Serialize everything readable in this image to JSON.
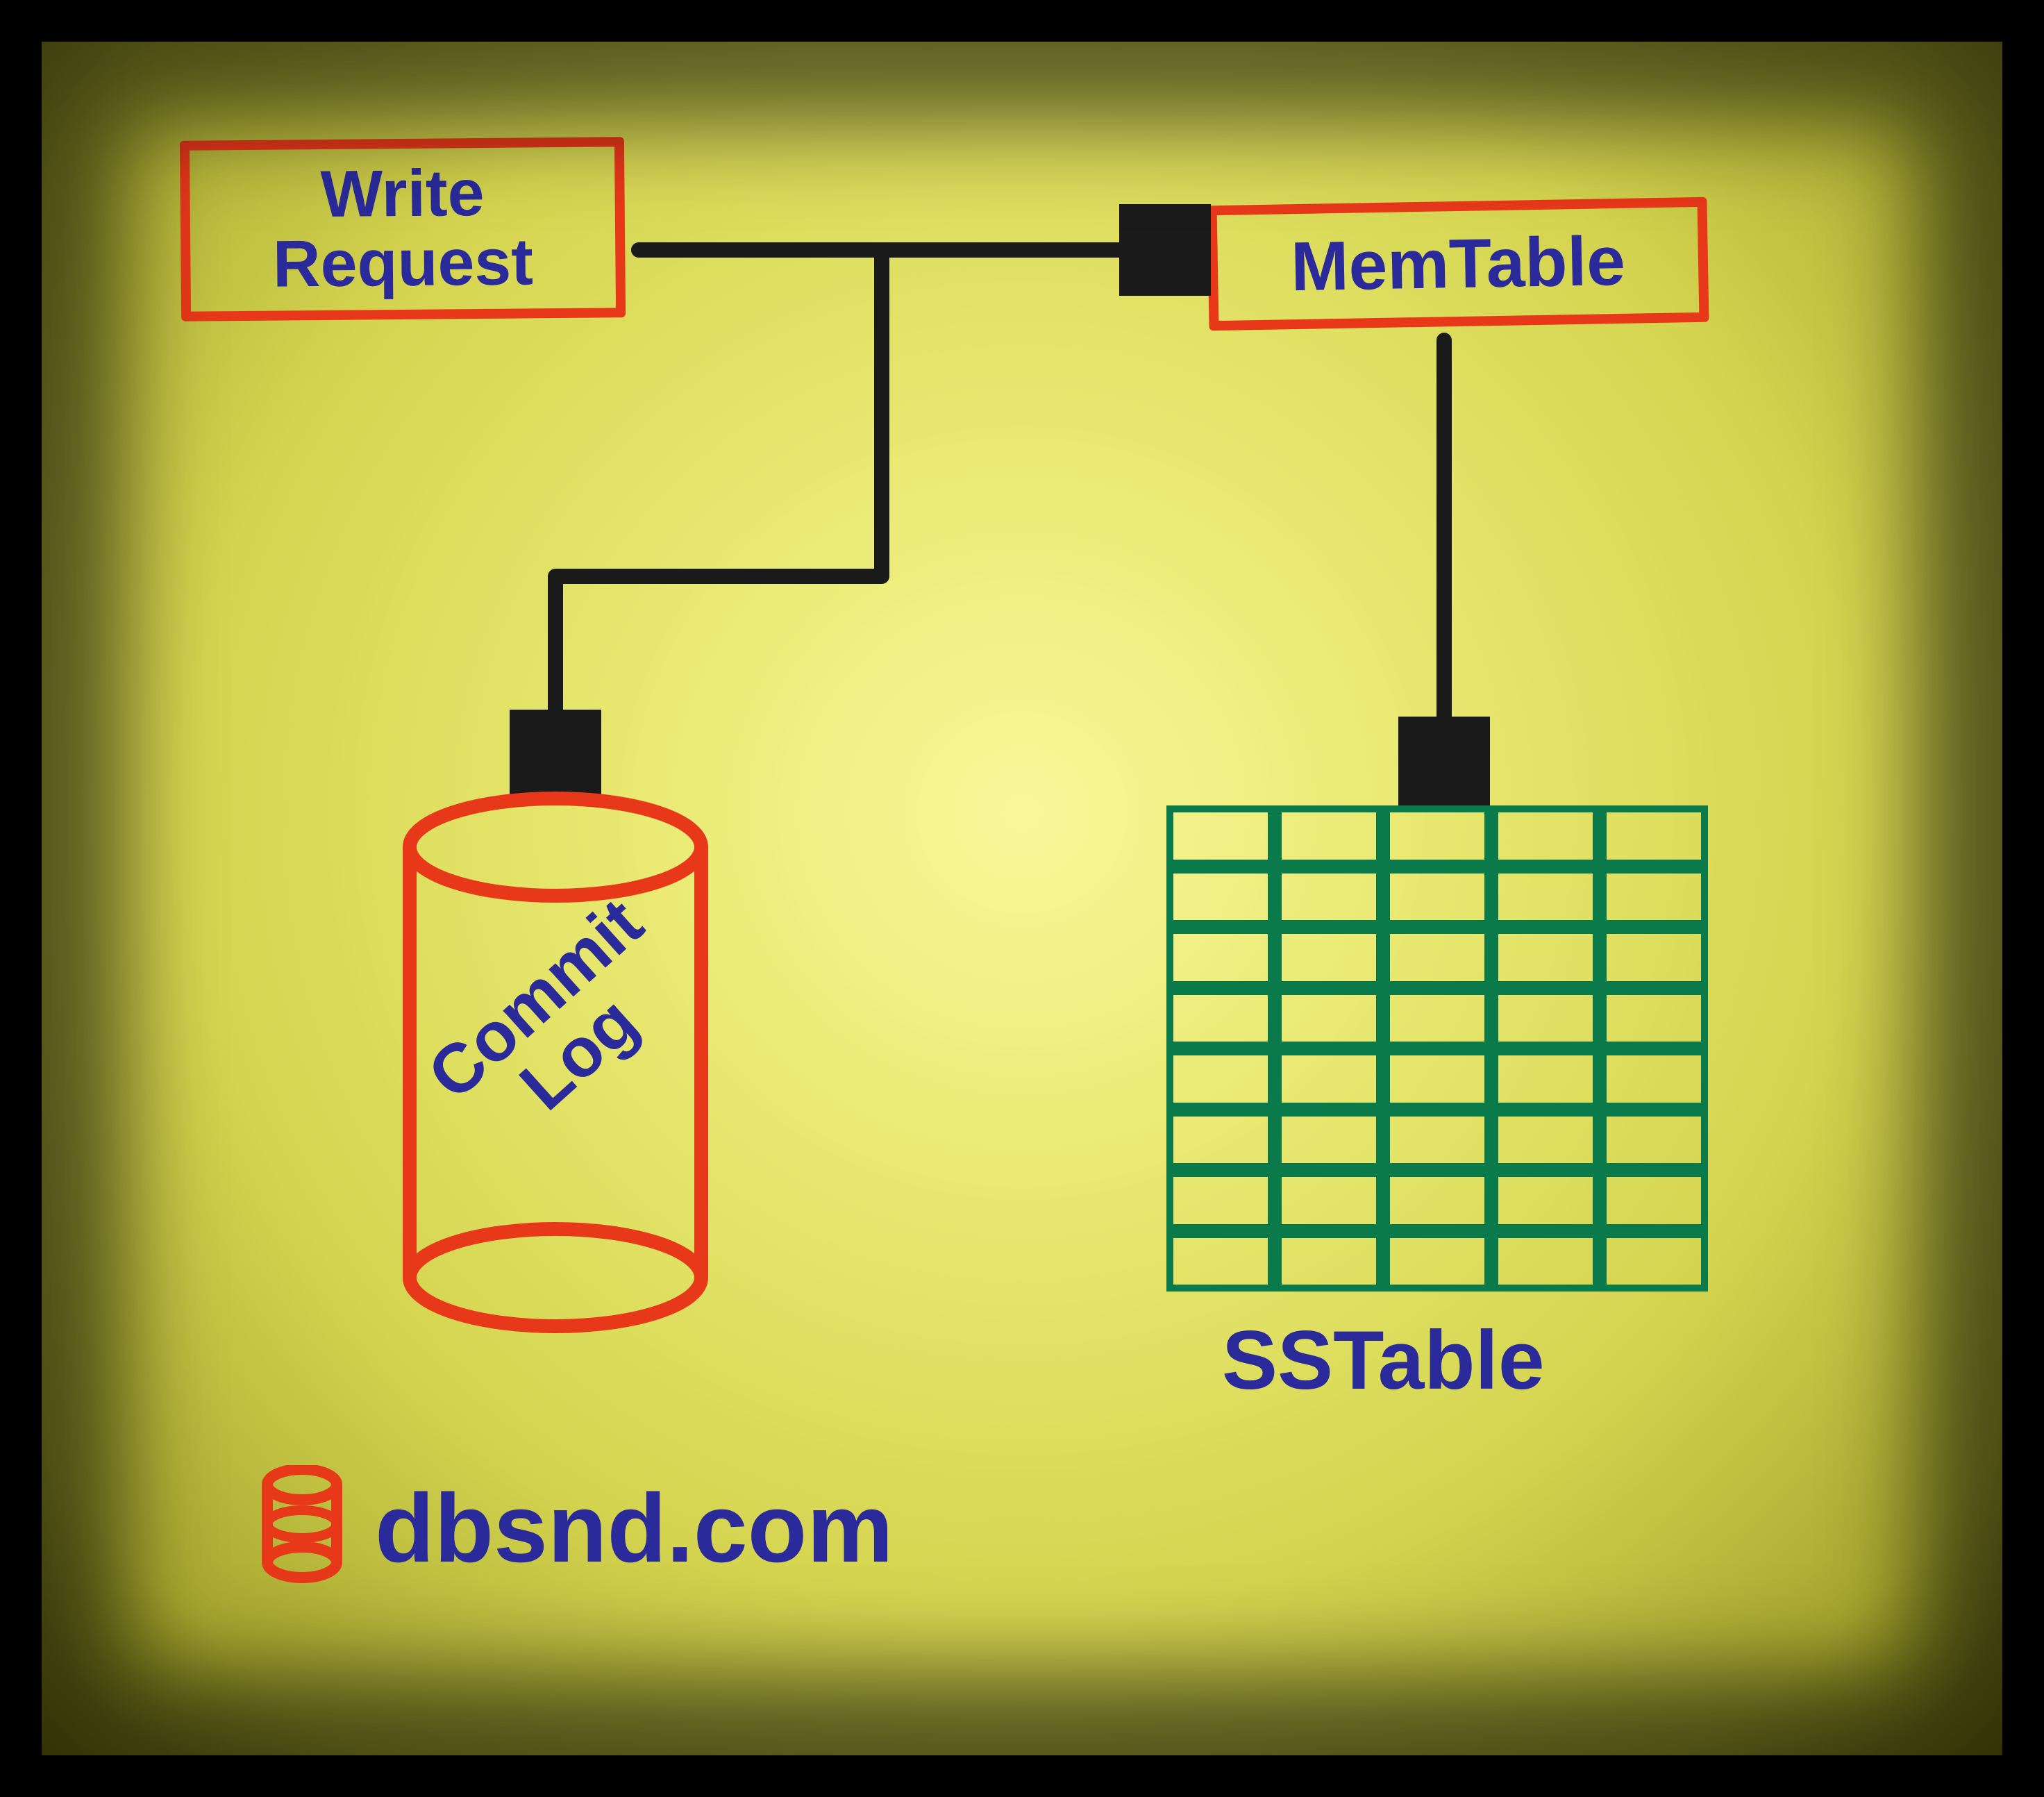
{
  "nodes": {
    "write_request": "Write\nRequest",
    "memtable": "MemTable",
    "commit_log": "Commit\nLog",
    "sstable": "SSTable"
  },
  "edges": [
    {
      "from": "write_request",
      "to": "memtable"
    },
    {
      "from": "write_request",
      "to": "commit_log"
    },
    {
      "from": "memtable",
      "to": "sstable"
    }
  ],
  "footer": {
    "site": "dbsnd.com"
  },
  "colors": {
    "box_border": "#e8381a",
    "text": "#2a2a9a",
    "arrow": "#1a1a1a",
    "grid": "#0a7a4a",
    "background": "#e8e870"
  }
}
